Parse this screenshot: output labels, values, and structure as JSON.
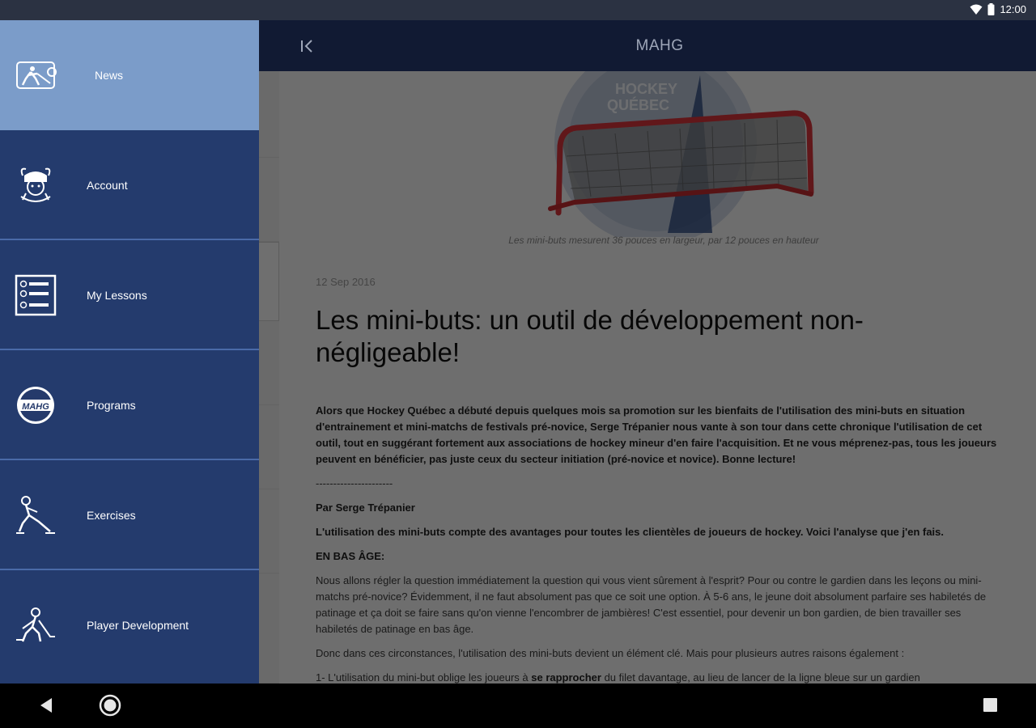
{
  "status_bar": {
    "time": "12:00"
  },
  "app_bar": {
    "title": "MAHG"
  },
  "drawer": {
    "items": [
      {
        "label": "News",
        "icon": "hockey-player-shield-icon",
        "active": true
      },
      {
        "label": "Account",
        "icon": "viking-mascot-icon"
      },
      {
        "label": "My Lessons",
        "icon": "checklist-icon"
      },
      {
        "label": "Programs",
        "icon": "mahg-logo-icon"
      },
      {
        "label": "Exercises",
        "icon": "skater-icon"
      },
      {
        "label": "Player Development",
        "icon": "player-with-stick-icon"
      }
    ]
  },
  "article": {
    "image_caption": "Les mini-buts mesurent 36 pouces en largeur, par 12 pouces en hauteur",
    "date": "12 Sep 2016",
    "title": "Les mini-buts: un outil de développement non-négligeable!",
    "intro": "Alors que Hockey Québec a débuté depuis quelques mois sa promotion sur les bienfaits de l'utilisation des mini-buts en situation d'entrainement et mini-matchs de festivals pré-novice, Serge Trépanier nous vante à son tour dans cette chronique l'utilisation de cet outil, tout en suggérant fortement aux associations de hockey mineur d'en faire l'acquisition. Et ne vous méprenez-pas, tous les joueurs peuvent en bénéficier, pas juste ceux du secteur initiation (pré-novice et novice). Bonne lecture!",
    "separator": "----------------------",
    "author": "Par Serge Trépanier",
    "lead": "L'utilisation des mini-buts compte des avantages pour toutes les clientèles de joueurs de hockey. Voici l'analyse que j'en fais.",
    "section_heading": "EN BAS ÂGE:",
    "paragraph1": "Nous allons régler la question immédiatement la question qui vous vient sûrement à l'esprit? Pour ou contre le gardien dans les leçons ou mini-matchs pré-novice? Évidemment, il ne faut absolument pas que ce soit une option. À 5-6 ans, le jeune doit absolument parfaire ses habiletés de patinage et ça doit se faire sans qu'on vienne l'encombrer de jambières! C'est essentiel, pour devenir un bon gardien, de bien travailler ses habiletés de patinage en bas âge.",
    "paragraph2": "Donc dans ces circonstances, l'utilisation des mini-buts devient un élément clé.  Mais pour plusieurs autres raisons également :",
    "list_item1_prefix": "1- L'utilisation du mini-but oblige les joueurs à ",
    "list_item1_bold": "se rapprocher",
    "list_item1_suffix": " du filet davantage, au lieu de lancer de la ligne bleue sur un gardien"
  },
  "hero_logo_text": {
    "line1": "HOCKEY",
    "line2": "QUÉBEC"
  },
  "colors": {
    "status_bar": "#2b3242",
    "app_bar": "#111a33",
    "drawer": "#243b6d",
    "drawer_active": "#7b9cc9",
    "drawer_divider": "#4a6aa8",
    "net_red": "#d8333a"
  }
}
